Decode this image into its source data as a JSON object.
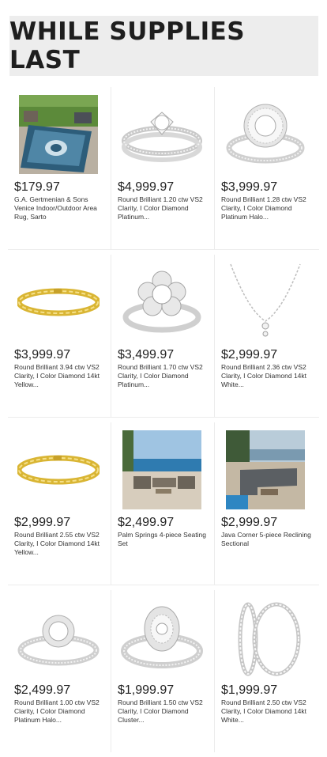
{
  "banner": {
    "title": "WHILE SUPPLIES LAST"
  },
  "products": [
    {
      "price": "$179.97",
      "desc": "G.A. Gertmenian & Sons Venice Indoor/Outdoor Area Rug, Sarto",
      "icon": "rug-image"
    },
    {
      "price": "$4,999.97",
      "desc": "Round Brilliant 1.20 ctw VS2 Clarity, I Color Diamond Platinum...",
      "icon": "ring-image"
    },
    {
      "price": "$3,999.97",
      "desc": "Round Brilliant 1.28 ctw VS2 Clarity, I Color Diamond Platinum Halo...",
      "icon": "halo-ring-image"
    },
    {
      "price": "$3,999.97",
      "desc": "Round Brilliant 3.94 ctw VS2 Clarity, I Color Diamond 14kt Yellow...",
      "icon": "bracelet-image"
    },
    {
      "price": "$3,499.97",
      "desc": "Round Brilliant 1.70 ctw VS2 Clarity, I Color Diamond Platinum...",
      "icon": "flower-ring-image"
    },
    {
      "price": "$2,999.97",
      "desc": "Round Brilliant 2.36 ctw VS2 Clarity, I Color Diamond 14kt White...",
      "icon": "necklace-image"
    },
    {
      "price": "$2,999.97",
      "desc": "Round Brilliant 2.55 ctw VS2 Clarity, I Color Diamond 14kt Yellow...",
      "icon": "bracelet-image"
    },
    {
      "price": "$2,499.97",
      "desc": "Palm Springs 4-piece Seating Set",
      "icon": "patio-set-image"
    },
    {
      "price": "$2,999.97",
      "desc": "Java Corner 5-piece Reclining Sectional",
      "icon": "sectional-image"
    },
    {
      "price": "$2,499.97",
      "desc": "Round Brilliant 1.00 ctw VS2 Clarity, I Color Diamond Platinum Halo...",
      "icon": "halo-ring-image"
    },
    {
      "price": "$1,999.97",
      "desc": "Round Brilliant 1.50 ctw VS2 Clarity, I Color Diamond Cluster...",
      "icon": "cluster-ring-image"
    },
    {
      "price": "$1,999.97",
      "desc": "Round Brilliant 2.50 ctw VS2 Clarity, I Color Diamond 14kt White...",
      "icon": "hoop-earrings-image"
    }
  ]
}
